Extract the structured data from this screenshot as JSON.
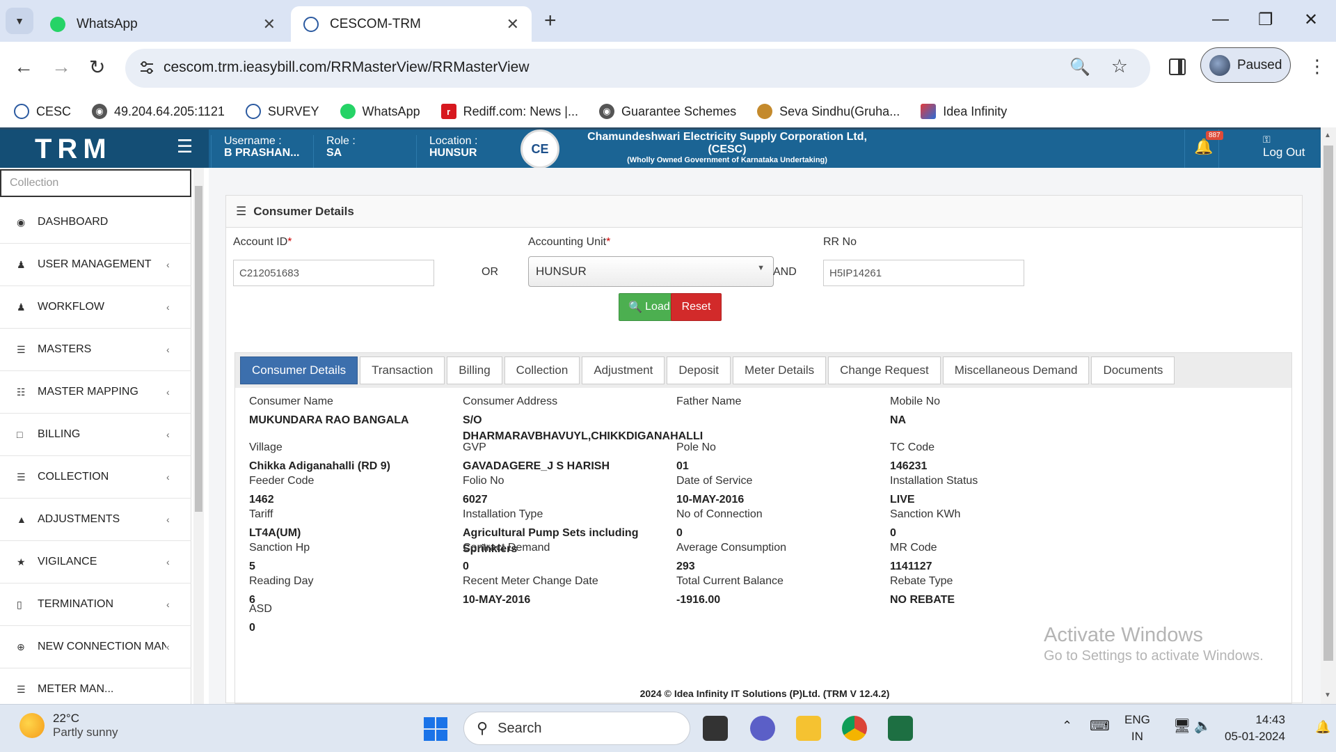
{
  "browser": {
    "tabs": [
      {
        "title": "WhatsApp",
        "icon": "whatsapp-icon",
        "active": false
      },
      {
        "title": "CESCOM-TRM",
        "icon": "cescom-icon",
        "active": true
      }
    ],
    "url": "cescom.trm.ieasybill.com/RRMasterView/RRMasterView",
    "profile_label": "Paused",
    "bookmarks": [
      {
        "label": "CESC",
        "icon": "cescom-icon"
      },
      {
        "label": "49.204.64.205:1121",
        "icon": "globe-icon"
      },
      {
        "label": "SURVEY",
        "icon": "cescom-icon"
      },
      {
        "label": "WhatsApp",
        "icon": "whatsapp-icon"
      },
      {
        "label": "Rediff.com: News |...",
        "icon": "rediff-icon"
      },
      {
        "label": "Guarantee Schemes",
        "icon": "globe-icon"
      },
      {
        "label": "Seva Sindhu(Gruha...",
        "icon": "emblem-icon"
      },
      {
        "label": "Idea Infinity",
        "icon": "idea-icon"
      }
    ]
  },
  "header": {
    "brand": "TRM",
    "username_label": "Username :",
    "username_value": "B PRASHAN...",
    "role_label": "Role :",
    "role_value": "SA",
    "location_label": "Location :",
    "location_value": "HUNSUR",
    "corp_name": "Chamundeshwari Electricity Supply Corporation Ltd,(CESC)",
    "corp_sub": "(Wholly Owned Government of Karnataka Undertaking)",
    "notification_count": "887",
    "logout_label": "Log Out"
  },
  "sidebar": {
    "search_placeholder": "Collection",
    "items": [
      {
        "label": "DASHBOARD",
        "icon": "dashboard-icon",
        "has_children": false
      },
      {
        "label": "USER MANAGEMENT",
        "icon": "user-icon",
        "has_children": true
      },
      {
        "label": "WORKFLOW",
        "icon": "user-icon",
        "has_children": true
      },
      {
        "label": "MASTERS",
        "icon": "list-icon",
        "has_children": true
      },
      {
        "label": "MASTER MAPPING",
        "icon": "sitemap-icon",
        "has_children": true
      },
      {
        "label": "BILLING",
        "icon": "monitor-icon",
        "has_children": true
      },
      {
        "label": "COLLECTION",
        "icon": "list-icon",
        "has_children": true
      },
      {
        "label": "ADJUSTMENTS",
        "icon": "adjust-icon",
        "has_children": true
      },
      {
        "label": "VIGILANCE",
        "icon": "vigilance-icon",
        "has_children": true
      },
      {
        "label": "TERMINATION",
        "icon": "trash-icon",
        "has_children": true
      },
      {
        "label": "NEW CONNECTION MANA...",
        "icon": "plus-circle-icon",
        "has_children": true
      },
      {
        "label": "METER MAN...",
        "icon": "list-icon",
        "has_children": false
      }
    ]
  },
  "panel": {
    "title": "Consumer Details",
    "account_id_label": "Account ID",
    "account_id_value": "C212051683",
    "or_label": "OR",
    "accounting_unit_label": "Accounting Unit",
    "accounting_unit_value": "HUNSUR",
    "and_label": "AND",
    "rr_no_label": "RR No",
    "rr_no_value": "H5IP14261",
    "load_label": "Load",
    "reset_label": "Reset"
  },
  "detail_tabs": [
    {
      "label": "Consumer Details",
      "active": true
    },
    {
      "label": "Transaction",
      "active": false
    },
    {
      "label": "Billing",
      "active": false
    },
    {
      "label": "Collection",
      "active": false
    },
    {
      "label": "Adjustment",
      "active": false
    },
    {
      "label": "Deposit",
      "active": false
    },
    {
      "label": "Meter Details",
      "active": false
    },
    {
      "label": "Change Request",
      "active": false
    },
    {
      "label": "Miscellaneous Demand",
      "active": false
    },
    {
      "label": "Documents",
      "active": false
    }
  ],
  "consumer_details": {
    "rows": [
      [
        {
          "label": "Consumer Name",
          "value": "MUKUNDARA RAO BANGALA"
        },
        {
          "label": "Consumer Address",
          "value": "S/O DHARMARAVBHAVUYL,CHIKKDIGANAHALLI"
        },
        {
          "label": "Father Name",
          "value": ""
        },
        {
          "label": "Mobile No",
          "value": "NA"
        }
      ],
      [
        {
          "label": "Village",
          "value": "Chikka Adiganahalli (RD 9)"
        },
        {
          "label": "GVP",
          "value": "GAVADAGERE_J S HARISH"
        },
        {
          "label": "Pole No",
          "value": "01"
        },
        {
          "label": "TC Code",
          "value": "146231"
        }
      ],
      [
        {
          "label": "Feeder Code",
          "value": "1462"
        },
        {
          "label": "Folio No",
          "value": "6027"
        },
        {
          "label": "Date of Service",
          "value": "10-MAY-2016"
        },
        {
          "label": "Installation Status",
          "value": "LIVE"
        }
      ],
      [
        {
          "label": "Tariff",
          "value": "LT4A(UM)"
        },
        {
          "label": "Installation Type",
          "value": "Agricultural Pump Sets including Sprinklers"
        },
        {
          "label": "No of Connection",
          "value": "0"
        },
        {
          "label": "Sanction KWh",
          "value": "0"
        }
      ],
      [
        {
          "label": "Sanction Hp",
          "value": "5"
        },
        {
          "label": "Contract Demand",
          "value": "0"
        },
        {
          "label": "Average Consumption",
          "value": "293"
        },
        {
          "label": "MR Code",
          "value": "1141127"
        }
      ],
      [
        {
          "label": "Reading Day",
          "value": "6"
        },
        {
          "label": "Recent Meter Change Date",
          "value": "10-MAY-2016"
        },
        {
          "label": "Total Current Balance",
          "value": "-1916.00"
        },
        {
          "label": "Rebate Type",
          "value": "NO REBATE"
        }
      ],
      [
        {
          "label": "ASD",
          "value": "0"
        }
      ]
    ]
  },
  "footer": "2024 © Idea Infinity IT Solutions (P)Ltd. (TRM V 12.4.2)",
  "watermark": {
    "line1": "Activate Windows",
    "line2": "Go to Settings to activate Windows."
  },
  "taskbar": {
    "temperature": "22°C",
    "weather": "Partly sunny",
    "search_placeholder": "Search",
    "lang1": "ENG",
    "lang2": "IN",
    "time": "14:43",
    "date": "05-01-2024"
  },
  "colors": {
    "appbar": "#1b6494",
    "active_tab": "#3c6fad",
    "load_button": "#4caf50",
    "reset_button": "#d22a2a"
  }
}
